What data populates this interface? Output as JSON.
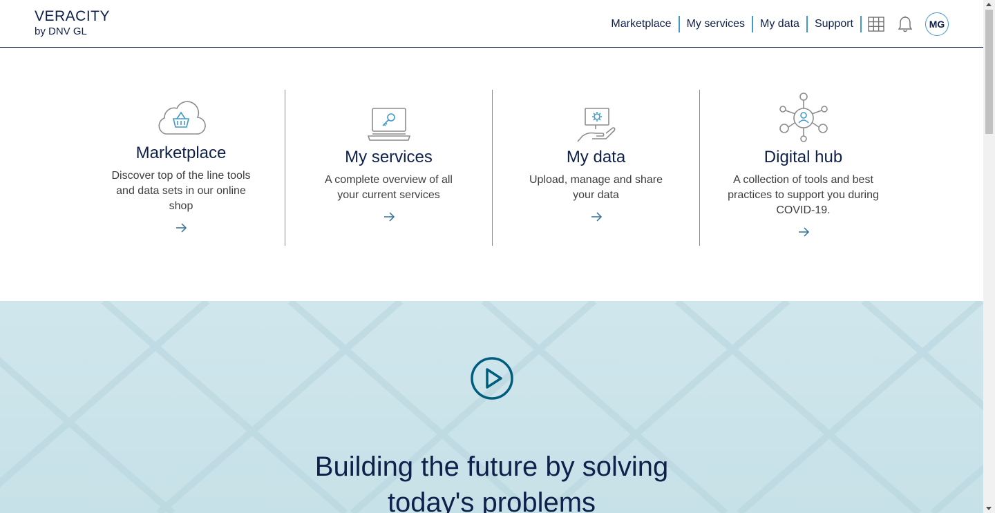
{
  "header": {
    "logo_main": "VERACITY",
    "logo_sub": "by DNV GL",
    "nav": [
      "Marketplace",
      "My services",
      "My data",
      "Support"
    ],
    "icons": [
      "grid-icon",
      "bell-icon"
    ],
    "avatar_initials": "MG",
    "accent_color": "#3f9ac9",
    "brand_color": "#0f204b"
  },
  "cards": [
    {
      "title": "Marketplace",
      "desc": "Discover top of the line tools and data sets in our online shop",
      "icon": "cloud-basket-icon"
    },
    {
      "title": "My services",
      "desc": "A complete overview of all your current services",
      "icon": "laptop-key-icon"
    },
    {
      "title": "My data",
      "desc": "Upload, manage and share your data",
      "icon": "hand-data-icon"
    },
    {
      "title": "Digital hub",
      "desc": "A collection of tools and best practices to support you during COVID-19.",
      "icon": "network-hub-icon"
    }
  ],
  "hero": {
    "title_line1": "Building the future by solving",
    "title_line2": "today's problems",
    "play_icon": "play-icon"
  }
}
